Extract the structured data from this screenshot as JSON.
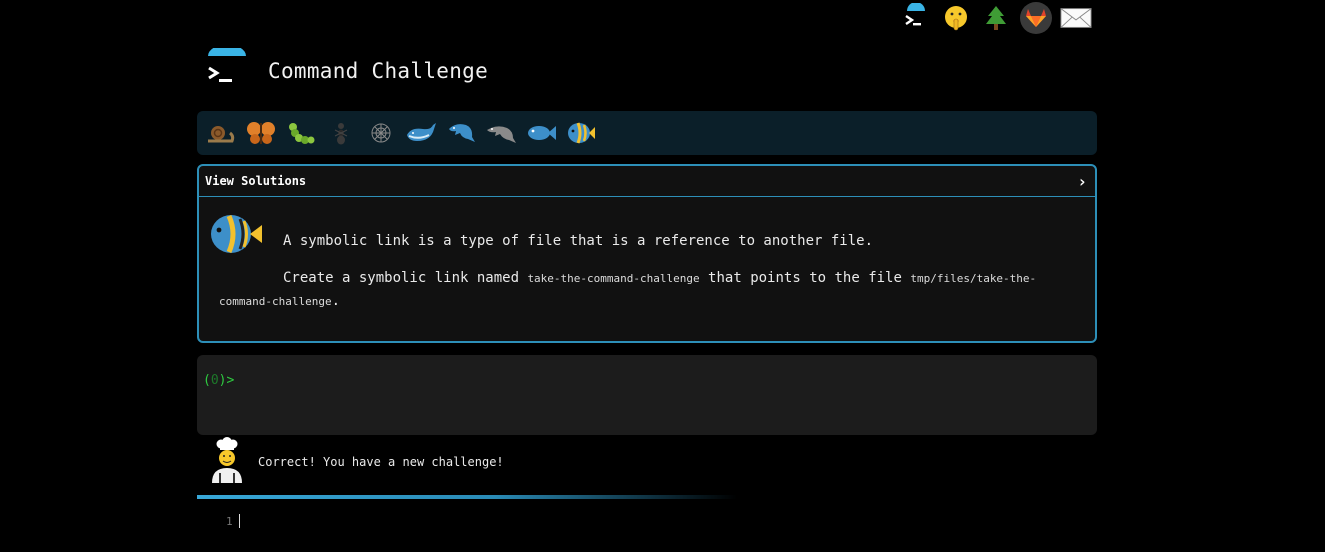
{
  "app": {
    "title": "Command Challenge"
  },
  "topbar": {
    "icons": [
      "terminal-logo-icon",
      "shushing-face-icon",
      "tree-icon",
      "gitlab-icon",
      "envelope-icon"
    ]
  },
  "levels": {
    "icons": [
      "snail-icon",
      "butterfly-icon",
      "caterpillar-icon",
      "ant-icon",
      "web-icon",
      "whale-icon",
      "dolphin-icon",
      "dolphin-gray-icon",
      "fish-icon",
      "tropical-fish-icon"
    ]
  },
  "challenge": {
    "toggle_label": "View Solutions",
    "toggle_chevron": "›",
    "line1": "A symbolic link is a type of file that is a reference to another file.",
    "line2_prefix": "Create a symbolic link named ",
    "line2_code1": "take-the-command-challenge",
    "line2_middle": " that points to the file ",
    "line2_code2": "tmp/files/take-the-command-challenge",
    "line2_suffix": "."
  },
  "terminal": {
    "prompt_open": "(",
    "prompt_count": "0",
    "prompt_close": ")>"
  },
  "feedback": {
    "message": "Correct! You have a new challenge!"
  },
  "progress": {
    "fraction": 0.6
  },
  "editor": {
    "line_number": "1"
  },
  "colors": {
    "accent": "#2d8fb8",
    "prompt": "#2ecc40",
    "background": "#000000"
  }
}
